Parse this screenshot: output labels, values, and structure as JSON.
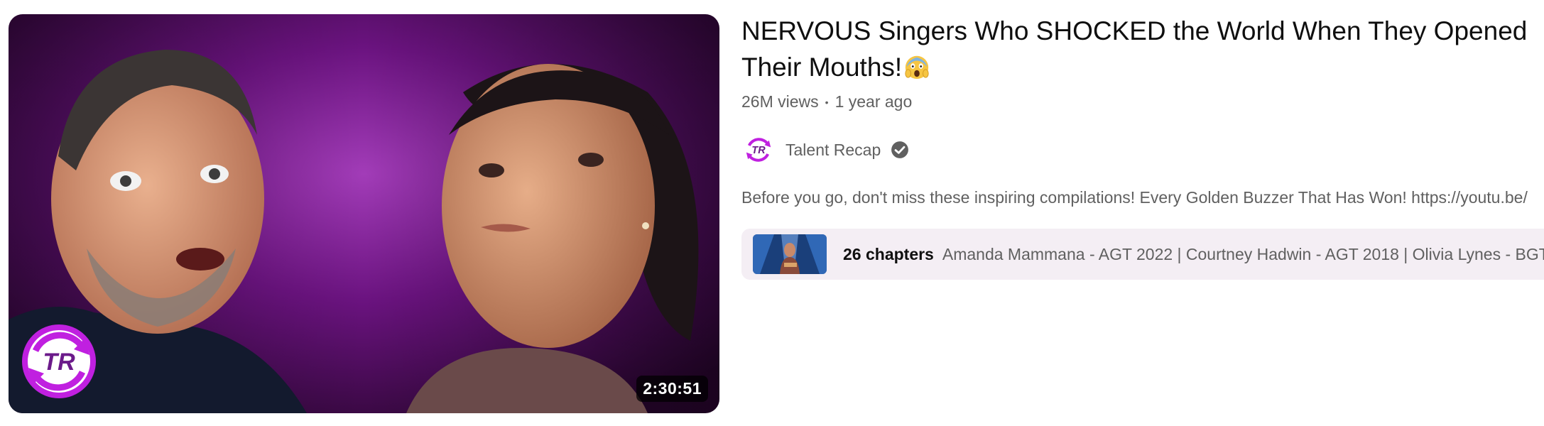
{
  "video": {
    "duration": "2:30:51",
    "title": "NERVOUS Singers Who SHOCKED the World When They Opened Their Mouths!",
    "title_emoji": "face-screaming-in-fear",
    "views": "26M views",
    "separator": "•",
    "age": "1 year ago",
    "description": "Before you go, don't miss these inspiring compilations! Every Golden Buzzer That Has Won! https://youtu.be/"
  },
  "channel": {
    "name": "Talent Recap",
    "avatar_icon": "talent-recap-logo-icon",
    "verified_icon": "verified-check-icon",
    "logo_text": "TR"
  },
  "chapters": {
    "count_label": "26 chapters",
    "preview": "Amanda Mammana - AGT 2022 | Courtney Hadwin - AGT 2018 | Olivia Lynes - BGT"
  },
  "colors": {
    "thumbnail_purple": "#5c0f6e",
    "brand_magenta": "#c020e0",
    "chapters_bg": "#f4eef4",
    "meta_gray": "#606060"
  }
}
